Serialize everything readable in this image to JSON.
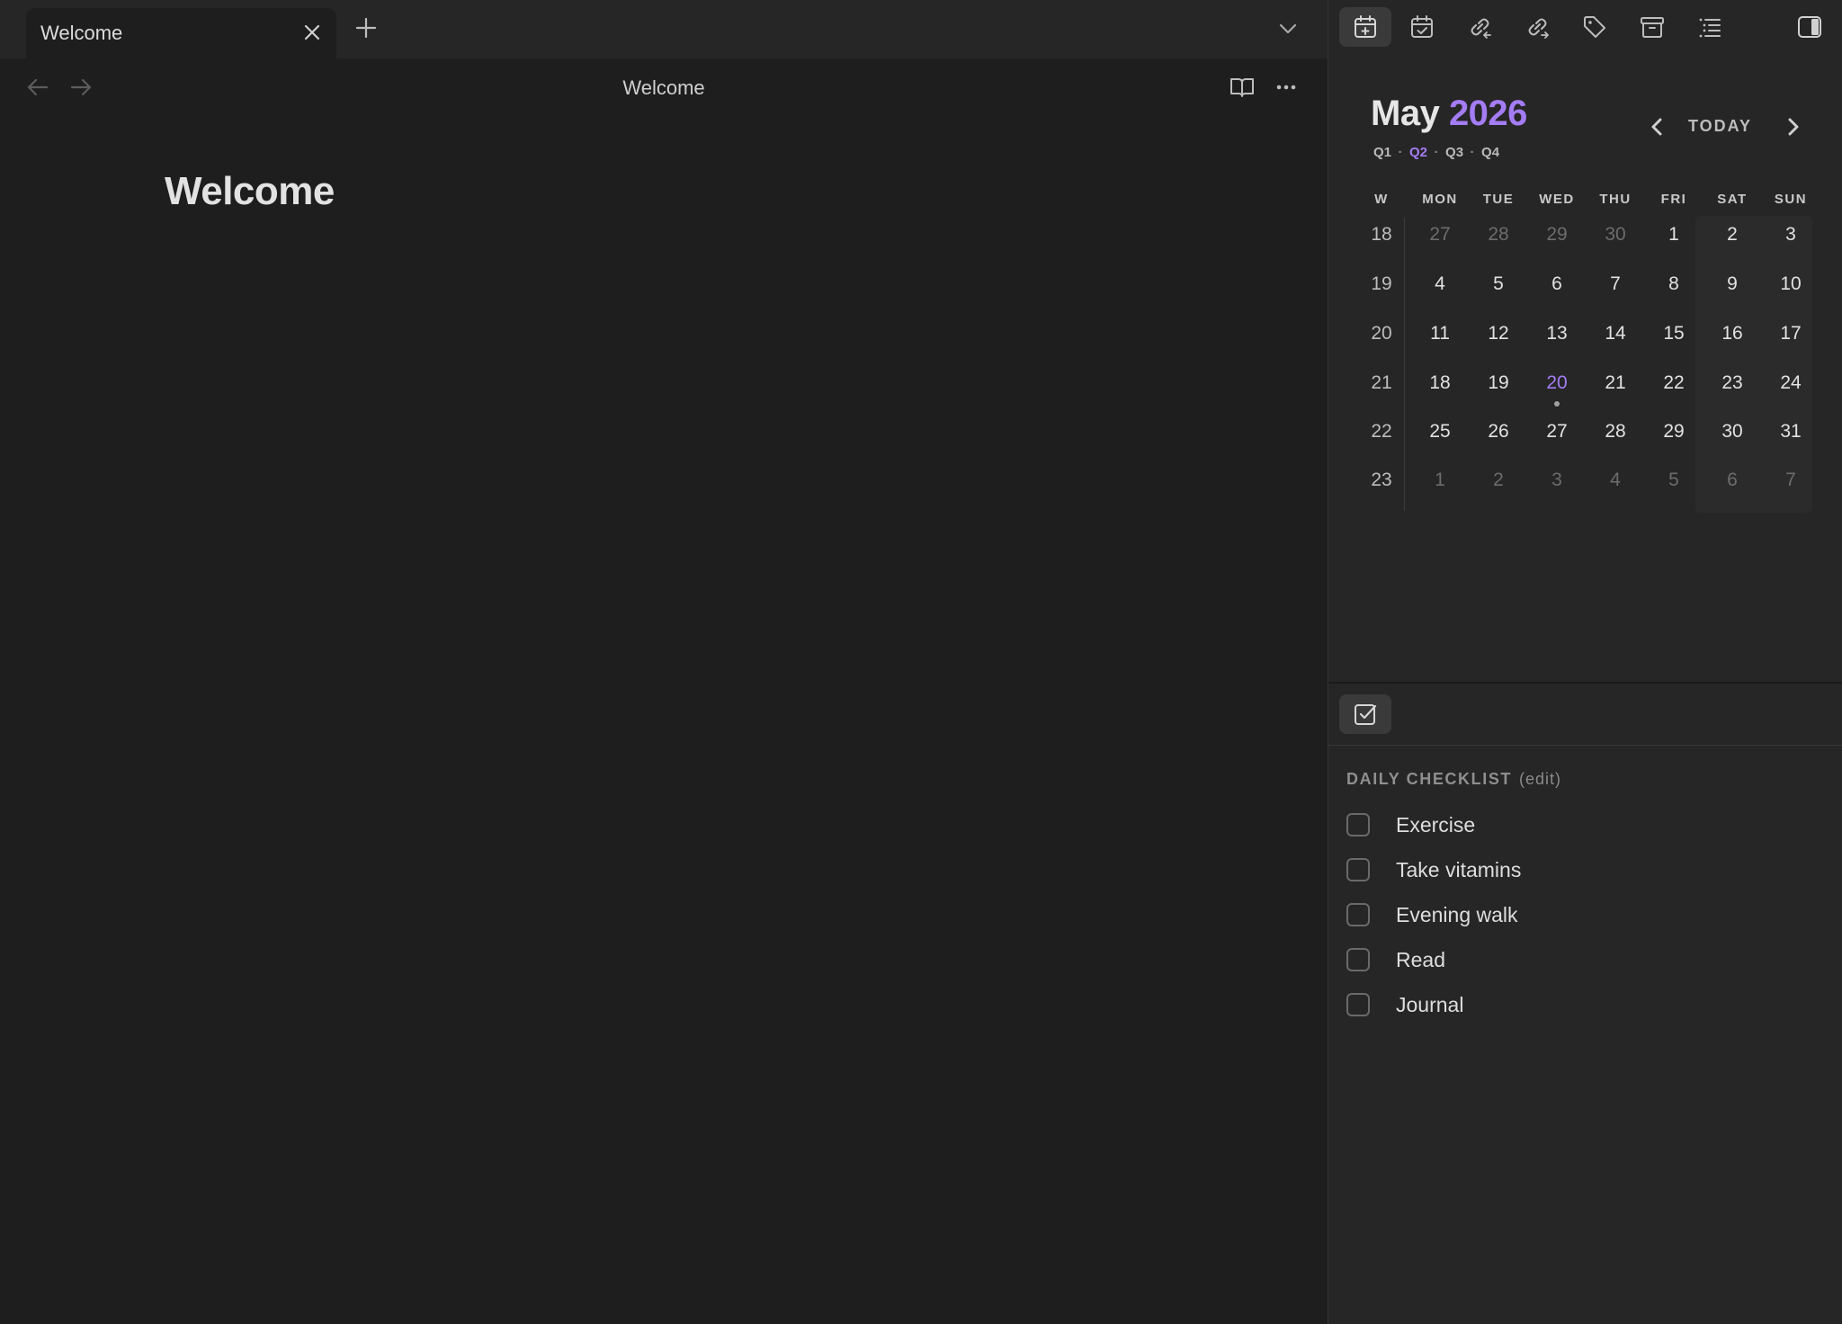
{
  "tabs": [
    {
      "title": "Welcome"
    }
  ],
  "editor": {
    "view_title": "Welcome",
    "note_title": "Welcome"
  },
  "sidebar": {
    "toolbar_icons": [
      "calendar-plus-icon",
      "calendar-check-icon",
      "backlinks-icon",
      "outgoing-links-icon",
      "tag-icon",
      "archive-icon",
      "outline-list-icon"
    ],
    "active_toolbar_index": 0
  },
  "calendar": {
    "month": "May",
    "year": "2026",
    "quarters": [
      "Q1",
      "Q2",
      "Q3",
      "Q4"
    ],
    "active_quarter": "Q2",
    "today_label": "TODAY",
    "header": [
      "W",
      "MON",
      "TUE",
      "WED",
      "THU",
      "FRI",
      "SAT",
      "SUN"
    ],
    "weeks": [
      {
        "week": "18",
        "days": [
          "27",
          "28",
          "29",
          "30",
          "1",
          "2",
          "3"
        ]
      },
      {
        "week": "19",
        "days": [
          "4",
          "5",
          "6",
          "7",
          "8",
          "9",
          "10"
        ]
      },
      {
        "week": "20",
        "days": [
          "11",
          "12",
          "13",
          "14",
          "15",
          "16",
          "17"
        ]
      },
      {
        "week": "21",
        "days": [
          "18",
          "19",
          "20",
          "21",
          "22",
          "23",
          "24"
        ]
      },
      {
        "week": "22",
        "days": [
          "25",
          "26",
          "27",
          "28",
          "29",
          "30",
          "31"
        ]
      },
      {
        "week": "23",
        "days": [
          "1",
          "2",
          "3",
          "4",
          "5",
          "6",
          "7"
        ]
      }
    ],
    "today": "20",
    "accent_color": "#a47cf3"
  },
  "checklist": {
    "heading": "DAILY CHECKLIST",
    "edit_label": "(edit)",
    "items": [
      {
        "label": "Exercise",
        "checked": false
      },
      {
        "label": "Take vitamins",
        "checked": false
      },
      {
        "label": "Evening walk",
        "checked": false
      },
      {
        "label": "Read",
        "checked": false
      },
      {
        "label": "Journal",
        "checked": false
      }
    ]
  }
}
